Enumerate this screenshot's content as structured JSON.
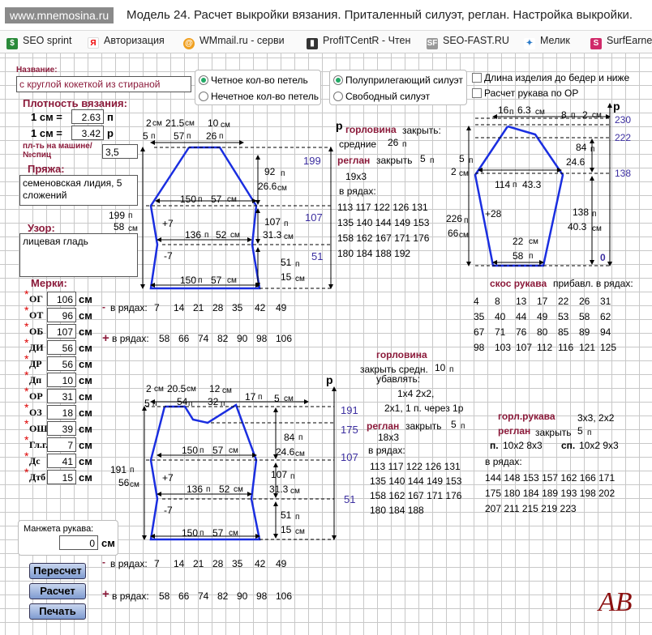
{
  "browser": {
    "url": "www.mnemosina.ru",
    "title": "Модель 24. Расчет выкройки вязания. Приталенный силуэт, реглан. Настройка выкройки."
  },
  "bookmarks": [
    "SEO sprint",
    "Авторизация",
    "WMmail.ru - серви",
    "ProfITCentR - Чтен",
    "SEO-FAST.RU",
    "Мелик",
    "SurfEarne"
  ],
  "form": {
    "name_label": "Название:",
    "name_value": "с круглой кокеткой из стираной пряжи",
    "density_label": "Плотность вязания:",
    "cm1": "1 см =",
    "loops_val": "2.63",
    "loops_unit": "п",
    "rows_val": "3.42",
    "rows_unit": "р",
    "needle_label": "пл-ть на машине/ №спиц",
    "needle_val": "3,5",
    "yarn_label": "Пряжа:",
    "yarn_value": "семеновская лидия, 5\nсложений",
    "pattern_label": "Узор:",
    "pattern_value": "лицевая гладь",
    "measures_label": "Мерки:",
    "measures": [
      {
        "k": "ОГ",
        "v": "106"
      },
      {
        "k": "ОТ",
        "v": "96"
      },
      {
        "k": "ОБ",
        "v": "107"
      },
      {
        "k": "ДИ",
        "v": "56"
      },
      {
        "k": "ДР",
        "v": "56"
      },
      {
        "k": "Дп",
        "v": "10"
      },
      {
        "k": "ОР",
        "v": "31"
      },
      {
        "k": "ОЗ",
        "v": "18"
      },
      {
        "k": "ОШ",
        "v": "39"
      },
      {
        "k": "Гл.г.",
        "v": "7"
      },
      {
        "k": "Дс",
        "v": "41"
      },
      {
        "k": "Дтб",
        "v": "15"
      }
    ],
    "cm": "см",
    "cuff_label": "Манжета рукава:",
    "cuff_val": "0",
    "cuff_unit": "см",
    "btn_recalc": "Пересчет",
    "btn_calc": "Расчет",
    "btn_print": "Печать"
  },
  "options": {
    "even": "Четное кол-во петель",
    "odd": "Нечетное кол-во петель",
    "semi": "Полуприлегающий силуэт",
    "free": "Свободный силуэт",
    "hip": "Длина изделия до бедер и ниже",
    "sleeve_or": "Расчет рукава по ОР"
  },
  "back": {
    "top": [
      "2",
      "21.5",
      "10"
    ],
    "top_units": [
      "см",
      "см",
      "см"
    ],
    "top2": [
      "5",
      "57",
      "26"
    ],
    "top2_units": [
      "п",
      "п",
      "п"
    ],
    "v92": "92",
    "v26_6": "26.6",
    "v150": "150",
    "v57": "57",
    "v199": "199",
    "v58": "58",
    "plus7": "+7",
    "v136": "136",
    "v52": "52",
    "v107": "107",
    "v31_3": "31.3",
    "minus7": "-7",
    "v51": "51",
    "v15": "15",
    "v150b": "150",
    "v57b": "57",
    "rc199": "199",
    "rc107": "107",
    "rc51": "51",
    "neck_label": "горловина",
    "neck_close": "закрыть:",
    "neck_mid": "средние",
    "neck_mid_val": "26",
    "raglan": "реглан",
    "raglan_close": "закрыть",
    "raglan_val": "5",
    "raglan_rows": "19х3",
    "in_rows": "в рядах:",
    "rows": [
      "113 117 122 126 131",
      "135 140 144 149 153",
      "158 162 167 171 176",
      "180 184 188 192"
    ],
    "minus_rows": [
      "7",
      "14",
      "21",
      "28",
      "35",
      "42",
      "49"
    ],
    "plus_rows": [
      "58",
      "66",
      "74",
      "82",
      "90",
      "98",
      "106"
    ],
    "in_rows2": "в рядах:"
  },
  "sleeve": {
    "p": "р",
    "top": [
      "16",
      "6.3",
      "8",
      "2"
    ],
    "v230": "230",
    "v222": "222",
    "v138": "138",
    "v84": "84",
    "v24_6": "24.6",
    "v5": "5",
    "v2": "2",
    "v114": "114",
    "v43": "43.3",
    "v28": "+28",
    "v226": "226",
    "v66": "66",
    "v138b": "138",
    "v40": "40.3",
    "v22": "22",
    "v58": "58",
    "v0": "0",
    "bevel": "скос рукава",
    "add": "прибавл. в рядах:",
    "rows": [
      [
        "4",
        "8",
        "13",
        "17",
        "22",
        "26",
        "31"
      ],
      [
        "35",
        "40",
        "44",
        "49",
        "53",
        "58",
        "62"
      ],
      [
        "67",
        "71",
        "76",
        "80",
        "85",
        "89",
        "94"
      ],
      [
        "98",
        "103",
        "107",
        "112",
        "116",
        "121",
        "125"
      ]
    ]
  },
  "front": {
    "neck_label": "горловина",
    "neck_close": "закрыть средн.",
    "neck_val": "10",
    "decr": "убавлять:",
    "d1": "1х4  2х2,",
    "d2": "2х1, 1 п. через 1р",
    "raglan": "реглан",
    "raglan_close": "закрыть",
    "raglan_val": "5",
    "raglan_rows": "18х3",
    "in_rows": "в рядах:",
    "rows": [
      "113 117 122 126 131",
      "135 140 144 149 153",
      "158 162 167 171 176",
      "180 184 188"
    ],
    "top": [
      "2",
      "20.5",
      "12",
      "17",
      "5"
    ],
    "top2": [
      "5",
      "54",
      "32"
    ],
    "rc191": "191",
    "rc175": "175",
    "rc107": "107",
    "rc51": "51",
    "v84": "84",
    "v24_6": "24.6",
    "v150": "150",
    "v57": "57",
    "v191": "191",
    "v56": "56",
    "v107": "107",
    "v31_3": "31.3",
    "v136": "136",
    "v52": "52",
    "v51": "51",
    "v15": "15",
    "v150b": "150",
    "v57b": "57",
    "sl_neck": "горл.рукава",
    "sl_raglan": "реглан",
    "sl_close": "закрыть",
    "sl_val": "5",
    "sl_33": "3х3,  2х2",
    "sl_p": "п.",
    "sl_p_val": "10х2 8х3",
    "sl_sp": "сп.",
    "sl_sp_val": "10х2 9х3",
    "sl_in": "в рядах:",
    "sl_rows": [
      "144 148 153 157 162 166 171",
      "175 180 184 189 193 198 202",
      "207 211 215 219 223"
    ]
  },
  "logo": "AB"
}
